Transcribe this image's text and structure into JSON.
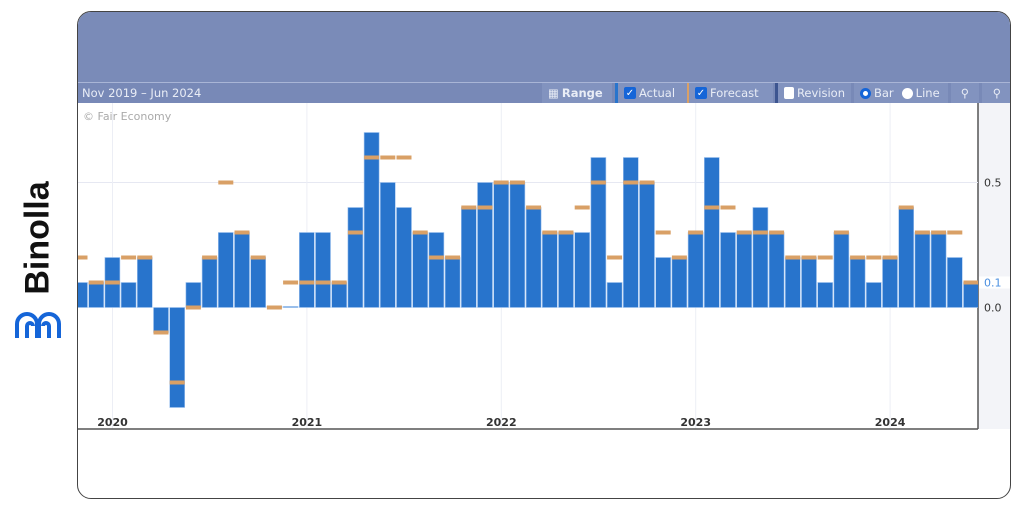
{
  "brand": {
    "name": "Binolla",
    "color": "#1565d8"
  },
  "toolbar": {
    "date_range": "Nov 2019 – Jun 2024",
    "range": "Range",
    "actual": "Actual",
    "forecast": "Forecast",
    "revision": "Revision",
    "bar": "Bar",
    "line": "Line",
    "actual_checked": true,
    "forecast_checked": true,
    "revision_checked": false,
    "mode": "Bar"
  },
  "chart_data": {
    "type": "bar",
    "watermark": "© Fair Economy",
    "categories": [
      "Nov 2019",
      "Dec 2019",
      "Jan 2020",
      "Feb 2020",
      "Mar 2020",
      "Apr 2020",
      "May 2020",
      "Jun 2020",
      "Jul 2020",
      "Aug 2020",
      "Sep 2020",
      "Oct 2020",
      "Nov 2020",
      "Dec 2020",
      "Jan 2021",
      "Feb 2021",
      "Mar 2021",
      "Apr 2021",
      "May 2021",
      "Jun 2021",
      "Jul 2021",
      "Aug 2021",
      "Sep 2021",
      "Oct 2021",
      "Nov 2021",
      "Dec 2021",
      "Jan 2022",
      "Feb 2022",
      "Mar 2022",
      "Apr 2022",
      "May 2022",
      "Jun 2022",
      "Jul 2022",
      "Aug 2022",
      "Sep 2022",
      "Oct 2022",
      "Nov 2022",
      "Dec 2022",
      "Jan 2023",
      "Feb 2023",
      "Mar 2023",
      "Apr 2023",
      "May 2023",
      "Jun 2023",
      "Jul 2023",
      "Aug 2023",
      "Sep 2023",
      "Oct 2023",
      "Nov 2023",
      "Dec 2023",
      "Jan 2024",
      "Feb 2024",
      "Mar 2024",
      "Apr 2024",
      "May 2024",
      "Jun 2024"
    ],
    "series": [
      {
        "name": "Actual",
        "color": "#2874cc",
        "values": [
          0.1,
          0.1,
          0.2,
          0.1,
          0.2,
          -0.1,
          -0.4,
          0.1,
          0.2,
          0.3,
          0.3,
          0.2,
          0.0,
          0.0,
          0.3,
          0.3,
          0.1,
          0.4,
          0.7,
          0.5,
          0.4,
          0.3,
          0.3,
          0.2,
          0.4,
          0.5,
          0.5,
          0.5,
          0.4,
          0.3,
          0.3,
          0.3,
          0.6,
          0.1,
          0.6,
          0.5,
          0.2,
          0.2,
          0.3,
          0.6,
          0.3,
          0.3,
          0.4,
          0.3,
          0.2,
          0.2,
          0.1,
          0.3,
          0.2,
          0.1,
          0.2,
          0.4,
          0.3,
          0.3,
          0.2,
          0.1
        ]
      },
      {
        "name": "Forecast",
        "color": "#d9a066",
        "values": [
          0.2,
          0.1,
          0.1,
          0.2,
          0.2,
          -0.1,
          -0.3,
          0.0,
          0.2,
          0.5,
          0.3,
          0.2,
          0.0,
          0.1,
          0.1,
          0.1,
          0.1,
          0.3,
          0.6,
          0.6,
          0.6,
          0.3,
          0.2,
          0.2,
          0.4,
          0.4,
          0.5,
          0.5,
          0.4,
          0.3,
          0.3,
          0.4,
          0.5,
          0.2,
          0.5,
          0.5,
          0.3,
          0.2,
          0.3,
          0.4,
          0.4,
          0.3,
          0.3,
          0.3,
          0.2,
          0.2,
          0.2,
          0.3,
          0.2,
          0.2,
          0.2,
          0.4,
          0.3,
          0.3,
          0.3,
          0.1
        ]
      }
    ],
    "x_tick_labels": [
      "2020",
      "2021",
      "2022",
      "2023",
      "2024"
    ],
    "y_tick_labels": [
      "0.5",
      "0.0"
    ],
    "last_value_label": "0.1",
    "ylim": [
      -0.53,
      0.78
    ],
    "grid": true
  }
}
